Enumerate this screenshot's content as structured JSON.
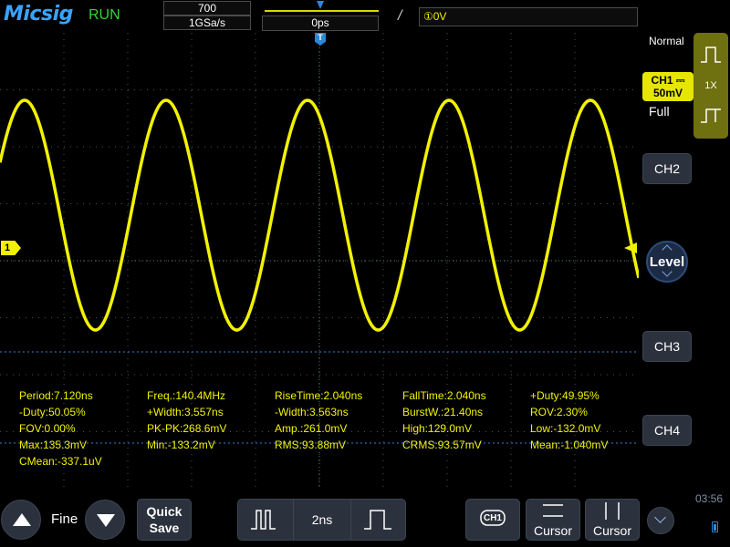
{
  "header": {
    "brand": "Micsig",
    "run_state": "RUN",
    "memory_depth": "700",
    "sample_rate": "1GSa/s",
    "trigger_position": "0ps",
    "trigger_edge_symbol": "/",
    "trigger_info": "①0V"
  },
  "channel_markers": {
    "ch1_left_label": "1",
    "trigger_top_label": "T"
  },
  "measurements": [
    [
      "Period:7.120ns",
      "Freq.:140.4MHz",
      "RiseTime:2.040ns",
      "FallTime:2.040ns",
      "+Duty:49.95%"
    ],
    [
      "-Duty:50.05%",
      "+Width:3.557ns",
      "-Width:3.563ns",
      "BurstW.:21.40ns",
      "ROV:2.30%"
    ],
    [
      "FOV:0.00%",
      "PK-PK:268.6mV",
      "Amp.:261.0mV",
      "High:129.0mV",
      "Low:-132.0mV"
    ],
    [
      "Max:135.3mV",
      "Min:-133.2mV",
      "RMS:93.88mV",
      "CRMS:93.57mV",
      "Mean:-1.040mV"
    ],
    [
      "CMean:-337.1uV"
    ]
  ],
  "right_panel": {
    "mode": "Normal",
    "ch1_name": "CH1 ⎓",
    "ch1_scale": "50mV",
    "bandwidth": "Full",
    "probe": "1X",
    "ch2": "CH2",
    "level": "Level",
    "ch3": "CH3",
    "ch4": "CH4"
  },
  "bottom_bar": {
    "fine": "Fine",
    "quick_save_1": "Quick",
    "quick_save_2": "Save",
    "timebase": "2ns",
    "ch1_button": "CH1",
    "cursor_h": "Cursor",
    "cursor_v": "Cursor",
    "clock": "03:56"
  },
  "colors": {
    "ch1": "#f2f200",
    "grid": "#3a5a5a",
    "accent": "#2e86d8",
    "run": "#34d534"
  },
  "waveform": {
    "period_ns": 7.12,
    "pkpk_mV": 268.6,
    "mean_mV": -1.04
  }
}
